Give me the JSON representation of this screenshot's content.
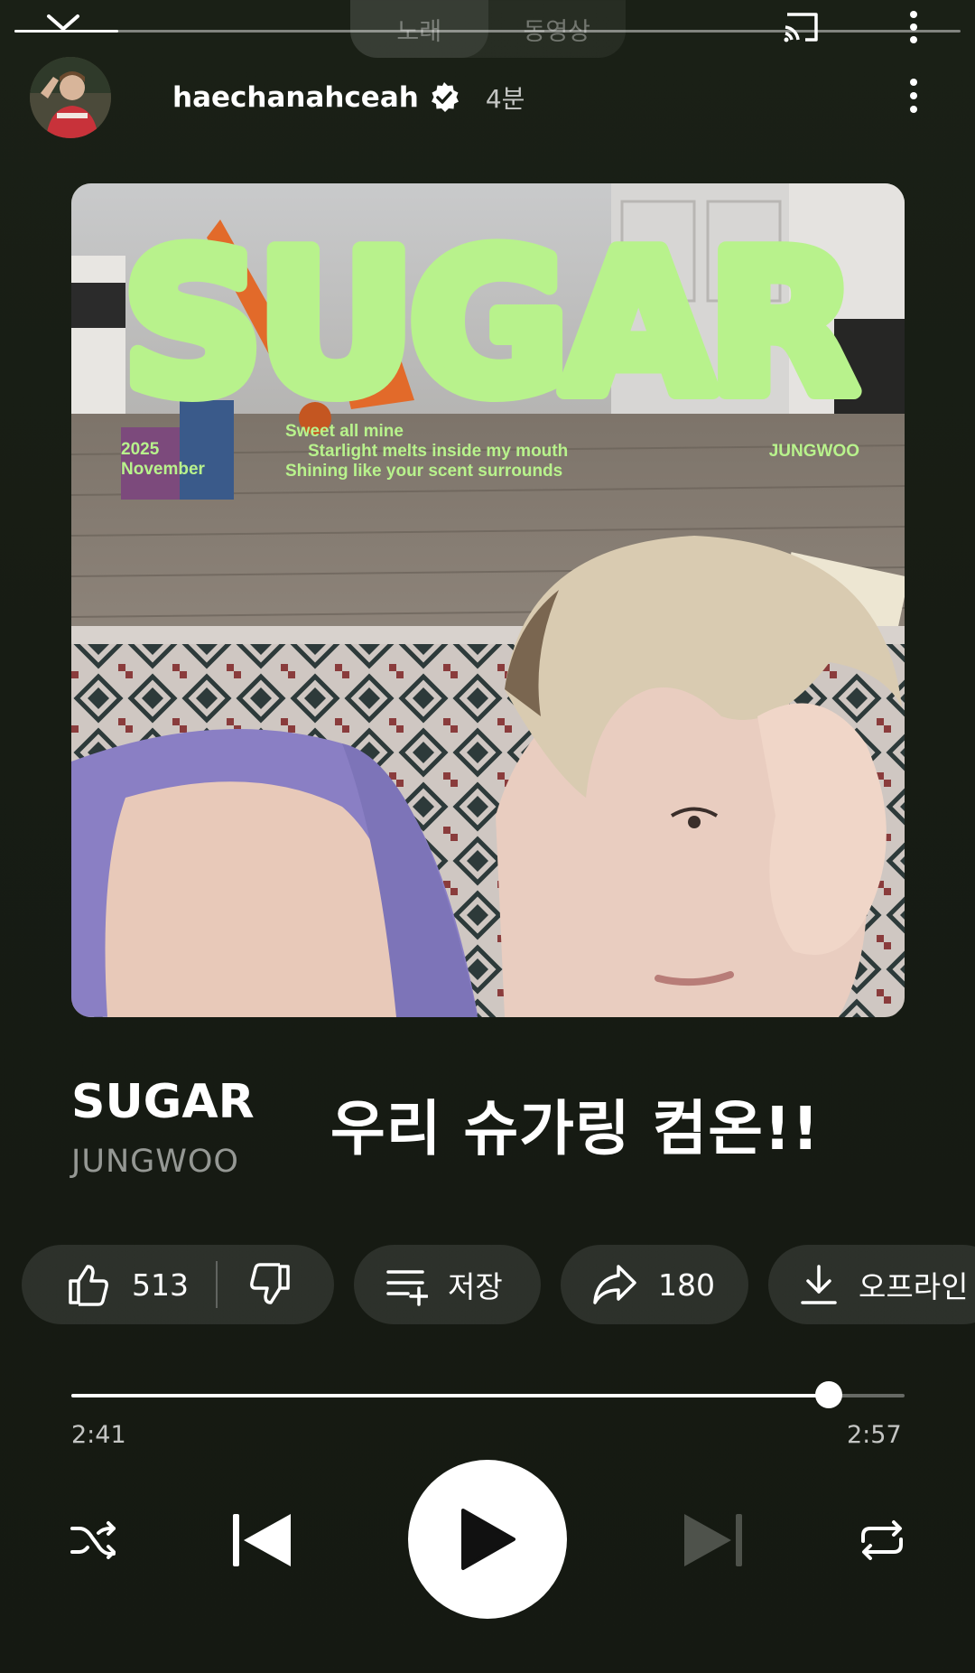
{
  "header": {
    "tabs": [
      {
        "label": "노래",
        "active": true
      },
      {
        "label": "동영상",
        "active": false
      }
    ]
  },
  "story": {
    "username": "haechanahceah",
    "verified": true,
    "time": "4분"
  },
  "album": {
    "title_art": "SUGAR",
    "date_line1": "2025",
    "date_line2": "November",
    "lyric_1": "Sweet all mine",
    "lyric_2": "Starlight melts inside my mouth",
    "lyric_3": "Shining like your scent surrounds",
    "artist_art": "JUNGWOO",
    "accent_color": "#b8f28c"
  },
  "song": {
    "title": "SUGAR",
    "artist": "JUNGWOO",
    "overlay_text": "우리 슈가링 컴온!!"
  },
  "actions": {
    "likes": "513",
    "save_label": "저장",
    "shares": "180",
    "download_label": "오프라인"
  },
  "player": {
    "current_time": "2:41",
    "total_time": "2:57",
    "progress_fraction": 0.909
  }
}
